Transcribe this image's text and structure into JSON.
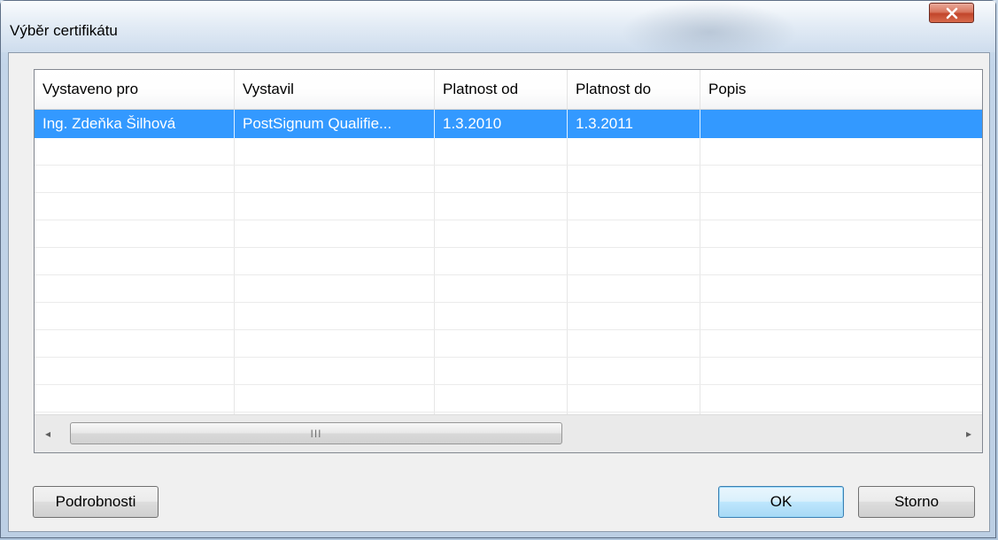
{
  "window": {
    "title": "Výběr certifikátu",
    "close_icon": "close-icon"
  },
  "list": {
    "columns": [
      "Vystaveno pro",
      "Vystavil",
      "Platnost od",
      "Platnost do",
      "Popis"
    ],
    "rows": [
      {
        "selected": true,
        "cells": [
          "Ing. Zdeňka Šilhová",
          "PostSignum Qualifie...",
          "1.3.2010",
          "1.3.2011",
          ""
        ]
      }
    ],
    "empty_rows": 11
  },
  "scrollbar": {
    "left_arrow": "◂",
    "right_arrow": "▸",
    "thumb_grip": "III"
  },
  "buttons": {
    "details_label": "Podrobnosti",
    "ok_label": "OK",
    "cancel_label": "Storno"
  },
  "colors": {
    "selection": "#3399ff",
    "close_button": "#c2452b"
  }
}
